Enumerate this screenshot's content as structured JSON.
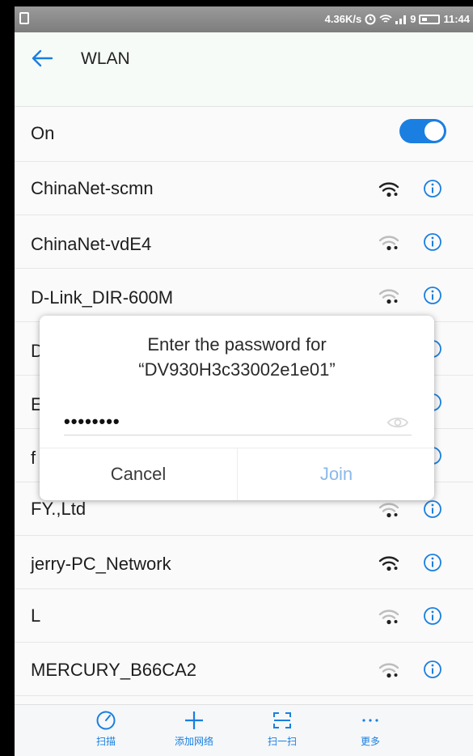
{
  "status_bar": {
    "speed": "4.36K/s",
    "signal": "9",
    "time": "11:44"
  },
  "header": {
    "title": "WLAN"
  },
  "wlan_toggle": {
    "label": "On",
    "state": "on"
  },
  "networks": [
    {
      "name": "ChinaNet-scmn",
      "signal": "strong"
    },
    {
      "name": "ChinaNet-vdE4",
      "signal": "weak"
    },
    {
      "name": "D-Link_DIR-600M",
      "signal": "weak"
    },
    {
      "name": "D",
      "signal": "weak"
    },
    {
      "name": "E",
      "signal": "weak"
    },
    {
      "name": "f",
      "signal": "weak"
    },
    {
      "name": "FY.,Ltd",
      "signal": "weak"
    },
    {
      "name": "jerry-PC_Network",
      "signal": "strong"
    },
    {
      "name": "L",
      "signal": "weak"
    },
    {
      "name": "MERCURY_B66CA2",
      "signal": "weak"
    }
  ],
  "dialog": {
    "title": "Enter the password for\n“DV930H3c33002e1e01”",
    "password_value": "••••••••",
    "cancel_label": "Cancel",
    "join_label": "Join"
  },
  "bottom_bar": [
    {
      "label": "扫描",
      "icon": "scan-gauge-icon"
    },
    {
      "label": "添加网络",
      "icon": "plus-icon"
    },
    {
      "label": "扫一扫",
      "icon": "qr-scan-icon"
    },
    {
      "label": "更多",
      "icon": "more-icon"
    }
  ],
  "colors": {
    "accent": "#1a7fe0",
    "join_disabled": "#8bb9e8"
  }
}
